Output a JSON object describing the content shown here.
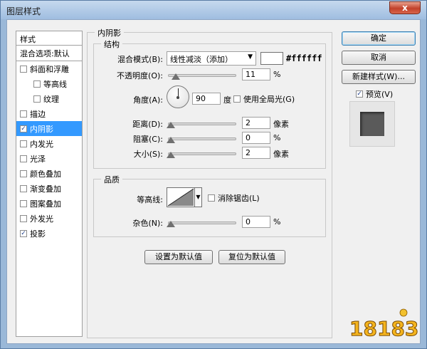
{
  "window": {
    "title": "图层样式",
    "close_glyph": "x"
  },
  "style_list": {
    "header": "样式",
    "blend_row": "混合选项:默认",
    "items": [
      {
        "label": "斜面和浮雕",
        "checked": false,
        "indent": false,
        "selected": false
      },
      {
        "label": "等高线",
        "checked": false,
        "indent": true,
        "selected": false
      },
      {
        "label": "纹理",
        "checked": false,
        "indent": true,
        "selected": false
      },
      {
        "label": "描边",
        "checked": false,
        "indent": false,
        "selected": false
      },
      {
        "label": "内阴影",
        "checked": true,
        "indent": false,
        "selected": true
      },
      {
        "label": "内发光",
        "checked": false,
        "indent": false,
        "selected": false
      },
      {
        "label": "光泽",
        "checked": false,
        "indent": false,
        "selected": false
      },
      {
        "label": "颜色叠加",
        "checked": false,
        "indent": false,
        "selected": false
      },
      {
        "label": "渐变叠加",
        "checked": false,
        "indent": false,
        "selected": false
      },
      {
        "label": "图案叠加",
        "checked": false,
        "indent": false,
        "selected": false
      },
      {
        "label": "外发光",
        "checked": false,
        "indent": false,
        "selected": false
      },
      {
        "label": "投影",
        "checked": true,
        "indent": false,
        "selected": false
      }
    ]
  },
  "inner_shadow": {
    "title": "内阴影",
    "structure": {
      "title": "结构",
      "blend_mode_label": "混合模式(B):",
      "blend_mode_value": "线性减淡（添加）",
      "color_hex": "#ffffff",
      "opacity_label": "不透明度(O):",
      "opacity_value": "11",
      "opacity_fraction": 0.11,
      "opacity_unit": "%",
      "angle_label": "角度(A):",
      "angle_value": "90",
      "angle_unit": "度",
      "global_light_label": "使用全局光(G)",
      "distance_label": "距离(D):",
      "distance_value": "2",
      "distance_unit": "像素",
      "choke_label": "阻塞(C):",
      "choke_value": "0",
      "choke_unit": "%",
      "size_label": "大小(S):",
      "size_value": "2",
      "size_unit": "像素"
    },
    "quality": {
      "title": "品质",
      "contour_label": "等高线:",
      "antialias_label": "消除锯齿(L)",
      "noise_label": "杂色(N):",
      "noise_value": "0",
      "noise_unit": "%"
    },
    "set_default": "设置为默认值",
    "reset_default": "复位为默认值"
  },
  "actions": {
    "ok": "确定",
    "cancel": "取消",
    "new_style": "新建样式(W)...",
    "preview_label": "预览(V)",
    "preview_checked": true
  },
  "watermark": {
    "text": "18183"
  },
  "colors": {
    "selection": "#3399ff",
    "title_bar": "#9fbde0",
    "close": "#c2412a"
  }
}
